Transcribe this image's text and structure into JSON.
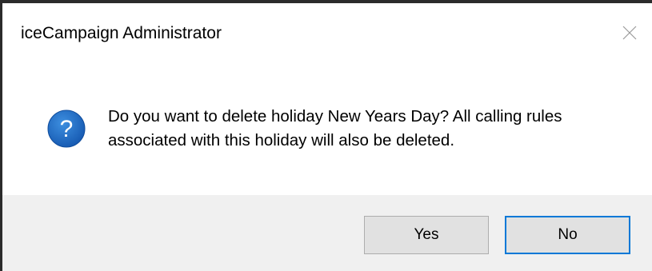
{
  "window": {
    "title": "iceCampaign Administrator",
    "close_icon": "close-icon"
  },
  "dialog": {
    "icon": "question-icon",
    "icon_glyph": "?",
    "icon_color": "#1565c0",
    "message": "Do you want to delete holiday New Years Day?  All calling rules associated with this holiday will also be deleted."
  },
  "buttons": {
    "yes_label": "Yes",
    "no_label": "No",
    "default_button": "No",
    "focus_color": "#0078d7"
  }
}
